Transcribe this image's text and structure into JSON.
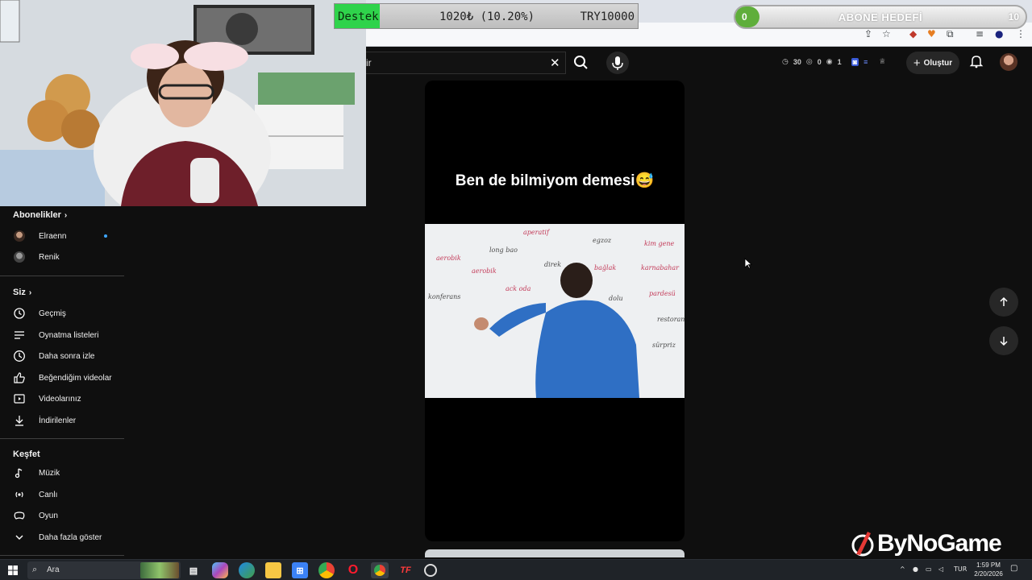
{
  "overlays": {
    "donation": {
      "label": "Destek",
      "amount": "1020₺ (10.20%)",
      "goal": "TRY10000"
    },
    "subscriber_goal": {
      "current": "0",
      "label": "ABONE HEDEFİ",
      "target": "10",
      "progress": 0.0
    },
    "watermark": {
      "text": "ByNoGame"
    }
  },
  "browser": {
    "tab_icons": [
      "cast-icon",
      "star-icon",
      "extension-icon",
      "puzzle-icon",
      "menu-icon"
    ]
  },
  "header": {
    "search": {
      "value": "ir",
      "clear_icon": "close-icon",
      "search_icon": "search-icon",
      "mic_icon": "mic-icon"
    },
    "stats": {
      "views": "30",
      "likes": "0",
      "comments": "1"
    },
    "create_label": "Oluştur",
    "notifications_icon": "bell-icon"
  },
  "sidebar": {
    "subscriptions": {
      "heading": "Abonelikler",
      "items": [
        {
          "label": "Elraenn",
          "has_new": true
        },
        {
          "label": "Renik",
          "has_new": false
        }
      ]
    },
    "you": {
      "heading": "Siz",
      "items": [
        {
          "label": "Geçmiş",
          "icon": "history-icon"
        },
        {
          "label": "Oynatma listeleri",
          "icon": "playlist-icon"
        },
        {
          "label": "Daha sonra izle",
          "icon": "clock-icon"
        },
        {
          "label": "Beğendiğim videolar",
          "icon": "thumbs-up-icon"
        },
        {
          "label": "Videolarınız",
          "icon": "video-icon"
        },
        {
          "label": "İndirilenler",
          "icon": "download-icon"
        }
      ]
    },
    "explore": {
      "heading": "Keşfet",
      "items": [
        {
          "label": "Müzik",
          "icon": "music-icon"
        },
        {
          "label": "Canlı",
          "icon": "live-icon"
        },
        {
          "label": "Oyun",
          "icon": "gaming-icon"
        },
        {
          "label": "Daha fazla göster",
          "icon": "chevron-down-icon"
        }
      ]
    }
  },
  "short": {
    "caption": "Ben de bilmiyom demesi😅",
    "whiteboard_words": [
      "aperatif",
      "long bao",
      "egzoz",
      "kim gene",
      "aerobik",
      "aerobik",
      "direk",
      "bağlak",
      "karnabahar",
      "ack oda",
      "dolu",
      "pardesü",
      "konferans",
      "sürpriz",
      "restoran"
    ]
  },
  "taskbar": {
    "search_placeholder": "Ara",
    "language": "TUR",
    "time": "1:59 PM",
    "date": "2/20/2026",
    "apps": [
      "task-view-icon",
      "copilot-icon",
      "edge-icon",
      "file-explorer-icon",
      "store-icon",
      "chrome-icon",
      "opera-icon",
      "chrome-active-icon",
      "tf-icon",
      "obs-icon"
    ]
  }
}
